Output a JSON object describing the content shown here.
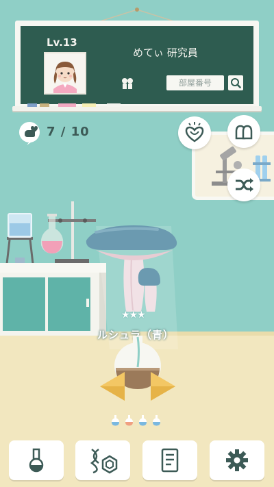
{
  "board": {
    "level": "Lv.13",
    "researcher_name": "めてぃ 研究員",
    "room_placeholder": "部屋番号"
  },
  "counter": {
    "text": "7 / 10"
  },
  "specimen": {
    "stars": "★★★",
    "name": "ルシュラ（青）"
  },
  "colors": {
    "wall": "#8fcfc6",
    "board": "#2e5c50",
    "floor": "#f2e7bf",
    "accent": "#3c5a56",
    "arrow": "#f3c764"
  },
  "icons": {
    "counter": "hand-heart-icon",
    "favorite": "heart-sparkle-icon",
    "friends": "friends-icon",
    "shuffle": "shuffle-icon",
    "search": "search-icon",
    "nav": [
      "flask-icon",
      "dna-crystal-icon",
      "notes-icon",
      "gear-icon"
    ]
  }
}
